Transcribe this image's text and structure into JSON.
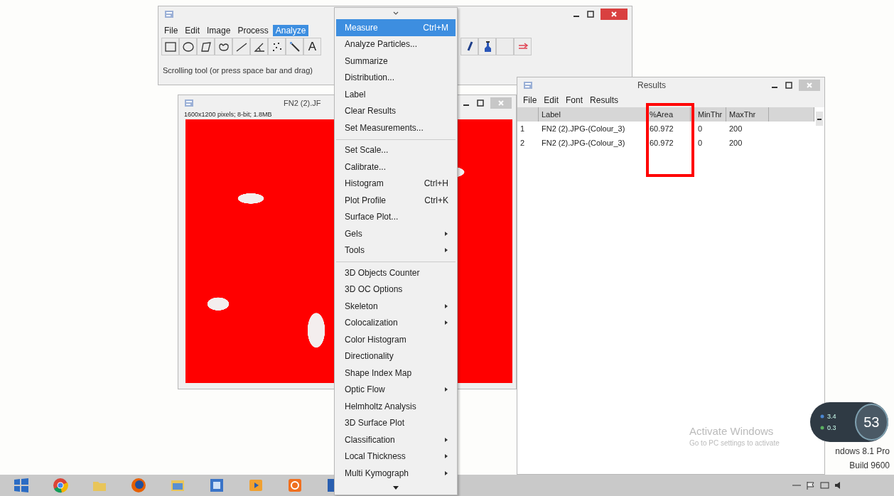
{
  "imagej": {
    "menus": [
      {
        "label": "File",
        "selected": false
      },
      {
        "label": "Edit",
        "selected": false
      },
      {
        "label": "Image",
        "selected": false
      },
      {
        "label": "Process",
        "selected": false
      },
      {
        "label": "Analyze",
        "selected": true
      }
    ],
    "tools_left": [
      {
        "kind": "rectangle"
      },
      {
        "kind": "oval"
      },
      {
        "kind": "polygon"
      },
      {
        "kind": "freehand"
      },
      {
        "kind": "line"
      },
      {
        "kind": "angle"
      },
      {
        "kind": "point"
      },
      {
        "kind": "wand"
      },
      {
        "kind": "text",
        "label": "A"
      }
    ],
    "tools_right": [
      {
        "kind": "brush"
      },
      {
        "kind": "dropper"
      },
      {
        "kind": "blank"
      },
      {
        "kind": "arrows"
      }
    ],
    "status": "Scrolling tool (or press space bar and drag)"
  },
  "image_window": {
    "title": "FN2 (2).JF",
    "info": "1600x1200 pixels; 8-bit; 1.8MB"
  },
  "analyze_menu": {
    "items": [
      {
        "kind": "item",
        "label": "Measure",
        "shortcut": "Ctrl+M",
        "selected": true,
        "submenu": false
      },
      {
        "kind": "item",
        "label": "Analyze Particles...",
        "selected": false,
        "submenu": false
      },
      {
        "kind": "item",
        "label": "Summarize",
        "selected": false,
        "submenu": false
      },
      {
        "kind": "item",
        "label": "Distribution...",
        "selected": false,
        "submenu": false
      },
      {
        "kind": "item",
        "label": "Label",
        "selected": false,
        "submenu": false
      },
      {
        "kind": "item",
        "label": "Clear Results",
        "selected": false,
        "submenu": false
      },
      {
        "kind": "item",
        "label": "Set Measurements...",
        "selected": false,
        "submenu": false
      },
      {
        "kind": "separator"
      },
      {
        "kind": "item",
        "label": "Set Scale...",
        "selected": false,
        "submenu": false
      },
      {
        "kind": "item",
        "label": "Calibrate...",
        "selected": false,
        "submenu": false
      },
      {
        "kind": "item",
        "label": "Histogram",
        "shortcut": "Ctrl+H",
        "selected": false,
        "submenu": false
      },
      {
        "kind": "item",
        "label": "Plot Profile",
        "shortcut": "Ctrl+K",
        "selected": false,
        "submenu": false
      },
      {
        "kind": "item",
        "label": "Surface Plot...",
        "selected": false,
        "submenu": false
      },
      {
        "kind": "item",
        "label": "Gels",
        "selected": false,
        "submenu": true
      },
      {
        "kind": "item",
        "label": "Tools",
        "selected": false,
        "submenu": true
      },
      {
        "kind": "separator"
      },
      {
        "kind": "item",
        "label": "3D Objects Counter",
        "selected": false,
        "submenu": false
      },
      {
        "kind": "item",
        "label": "3D OC Options",
        "selected": false,
        "submenu": false
      },
      {
        "kind": "item",
        "label": "Skeleton",
        "selected": false,
        "submenu": true
      },
      {
        "kind": "item",
        "label": "Colocalization",
        "selected": false,
        "submenu": true
      },
      {
        "kind": "item",
        "label": "Color Histogram",
        "selected": false,
        "submenu": false
      },
      {
        "kind": "item",
        "label": "Directionality",
        "selected": false,
        "submenu": false
      },
      {
        "kind": "item",
        "label": "Shape Index Map",
        "selected": false,
        "submenu": false
      },
      {
        "kind": "item",
        "label": "Optic Flow",
        "selected": false,
        "submenu": true
      },
      {
        "kind": "item",
        "label": "Helmholtz Analysis",
        "selected": false,
        "submenu": false
      },
      {
        "kind": "item",
        "label": "3D Surface Plot",
        "selected": false,
        "submenu": false
      },
      {
        "kind": "item",
        "label": "Classification",
        "selected": false,
        "submenu": true
      },
      {
        "kind": "item",
        "label": "Local Thickness",
        "selected": false,
        "submenu": true
      },
      {
        "kind": "item",
        "label": "Multi Kymograph",
        "selected": false,
        "submenu": true
      }
    ]
  },
  "results": {
    "title": "Results",
    "menus": [
      "File",
      "Edit",
      "Font",
      "Results"
    ],
    "columns": [
      "Label",
      "%Area",
      "MinThr",
      "MaxThr"
    ],
    "rows": [
      {
        "index": "1",
        "cells": [
          "FN2 (2).JPG-(Colour_3)",
          "60.972",
          "0",
          "200"
        ]
      },
      {
        "index": "2",
        "cells": [
          "FN2 (2).JPG-(Colour_3)",
          "60.972",
          "0",
          "200"
        ]
      }
    ]
  },
  "activation": {
    "title": "Activate Windows",
    "subtitle": "Go to PC settings to activate"
  },
  "edition": [
    "ndows 8.1 Pro",
    "Build 9600"
  ],
  "meter": {
    "upload": "3.4",
    "download": "0.3",
    "percent": "53"
  },
  "taskbar": {
    "apps": [
      {
        "kind": "start"
      },
      {
        "kind": "chrome"
      },
      {
        "kind": "folder"
      },
      {
        "kind": "firefox"
      },
      {
        "kind": "files"
      },
      {
        "kind": "blue-app"
      },
      {
        "kind": "media"
      },
      {
        "kind": "orange-app"
      },
      {
        "kind": "tile"
      }
    ]
  }
}
